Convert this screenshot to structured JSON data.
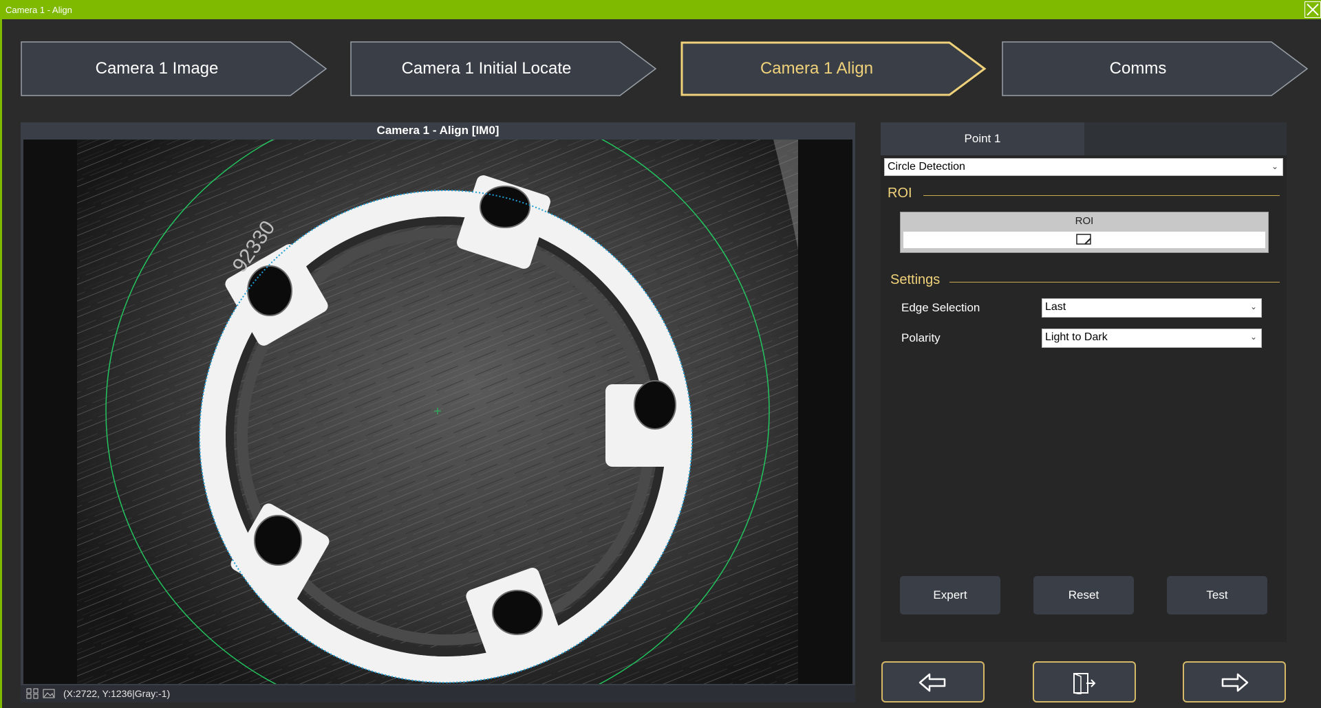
{
  "window": {
    "title": "Camera 1 - Align"
  },
  "steps": [
    {
      "label": "Camera 1 Image",
      "active": false
    },
    {
      "label": "Camera 1 Initial Locate",
      "active": false
    },
    {
      "label": "Camera 1 Align",
      "active": true
    },
    {
      "label": "Comms",
      "active": false
    }
  ],
  "image_panel": {
    "title": "Camera 1 - Align  [IM0]",
    "status": "(X:2722, Y:1236|Gray:-1)"
  },
  "right_panel": {
    "tab": "Point 1",
    "tool_select": "Circle Detection",
    "roi_group": "ROI",
    "roi_label": "ROI",
    "settings_group": "Settings",
    "settings": [
      {
        "label": "Edge Selection",
        "value": "Last"
      },
      {
        "label": "Polarity",
        "value": "Light to Dark"
      }
    ],
    "buttons": {
      "expert": "Expert",
      "reset": "Reset",
      "test": "Test"
    }
  },
  "icons": {
    "close": "close-icon",
    "back": "arrow-left-icon",
    "exit": "exit-door-icon",
    "next": "arrow-right-icon",
    "roi_edit": "roi-edit-icon"
  },
  "colors": {
    "titlebar": "#7fba00",
    "panel": "#3a3f47",
    "accent": "#f0d27a",
    "detection": "#22c55e"
  }
}
